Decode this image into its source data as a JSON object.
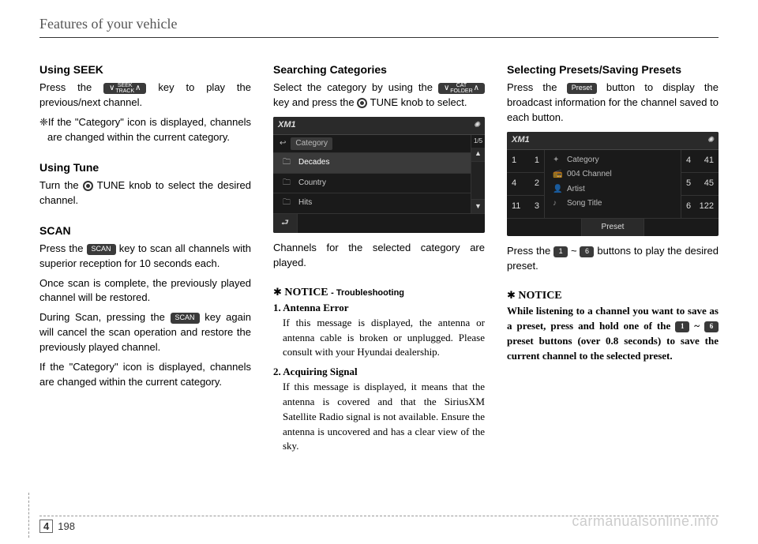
{
  "header": "Features of your vehicle",
  "col1": {
    "seek": {
      "title": "Using SEEK",
      "key_top": "SEEK",
      "key_bottom": "TRACK",
      "p1a": "Press the ",
      "p1b": " key to play the previous/next channel.",
      "bullet": "❈If the \"Category\" icon is displayed, channels are changed within the current category."
    },
    "tune": {
      "title": "Using Tune",
      "p1a": "Turn the ",
      "p1b": " TUNE knob to select the desired channel."
    },
    "scan": {
      "title": "SCAN",
      "key": "SCAN",
      "p1a": "Press the ",
      "p1b": " key to scan all channels with superior reception for 10 seconds each.",
      "p2": "Once scan is complete, the previously played channel will be restored.",
      "p3a": "During Scan, pressing the ",
      "p3b": " key again will cancel the scan operation and restore the previously played channel.",
      "p4": "If the \"Category\" icon is displayed, channels are changed within the current category."
    }
  },
  "col2": {
    "search": {
      "title": "Searching Categories",
      "key_top": "CAT",
      "key_bottom": "FOLDER",
      "p1a": "Select the category by using the ",
      "p1b": " key and press the ",
      "p1c": " TUNE knob to select.",
      "after": "Channels for the selected category are played."
    },
    "screenshot": {
      "header_title": "XM1",
      "header_icon": "✺",
      "topic_icon": "↩",
      "topic_label": "Category",
      "counter": "1/5",
      "rows": [
        {
          "icon": "🗀",
          "label": "Decades",
          "selected": true
        },
        {
          "icon": "🗀",
          "label": "Country",
          "selected": false
        },
        {
          "icon": "🗀",
          "label": "Hits",
          "selected": false
        }
      ],
      "back_icon": "⮐"
    },
    "notice": {
      "title_star": "✱",
      "title_bold": "NOTICE",
      "title_sub": " - Troubleshooting",
      "items": [
        {
          "num": "1.",
          "head": "Antenna Error",
          "body": "If this message is displayed, the antenna or antenna cable is broken or unplugged. Please consult with your Hyundai dealership."
        },
        {
          "num": "2.",
          "head": "Acquiring Signal",
          "body": "If this message is displayed, it means that the antenna is covered and that the SiriusXM Satellite Radio signal is not available. Ensure the antenna is uncovered and has a clear view of the sky."
        }
      ]
    }
  },
  "col3": {
    "presets": {
      "title": "Selecting Presets/Saving Presets",
      "key": "Preset",
      "p1a": "Press the ",
      "p1b": " button to display the broadcast information for the channel saved to each button.",
      "p2a": "Press the ",
      "p2b": " ~ ",
      "p2c": " buttons to play the desired preset.",
      "key1": "1",
      "key6": "6"
    },
    "screenshot": {
      "header_title": "XM1",
      "header_icon": "✺",
      "left_col": [
        {
          "n": "1",
          "v": "1"
        },
        {
          "n": "4",
          "v": "2"
        },
        {
          "n": "11",
          "v": "3"
        }
      ],
      "mid": [
        {
          "icon": "✦",
          "label": "Category"
        },
        {
          "icon": "📻",
          "label": "004 Channel"
        },
        {
          "icon": "👤",
          "label": "Artist"
        },
        {
          "icon": "♪",
          "label": "Song Title"
        }
      ],
      "right_col": [
        {
          "n": "4",
          "v": "41"
        },
        {
          "n": "5",
          "v": "45"
        },
        {
          "n": "6",
          "v": "122"
        }
      ],
      "foot_label": "Preset"
    },
    "notice": {
      "title_star": "✱",
      "title_bold": "NOTICE",
      "p_a": "While listening to a channel you want to save as a preset, press and hold one of the ",
      "p_b": " ~ ",
      "p_c": " preset buttons (over 0.8 seconds) to save the current channel to the selected preset.",
      "key1": "1",
      "key6": "6"
    }
  },
  "footer": {
    "chapter": "4",
    "page": "198"
  },
  "watermark": "carmanualsonline.info"
}
